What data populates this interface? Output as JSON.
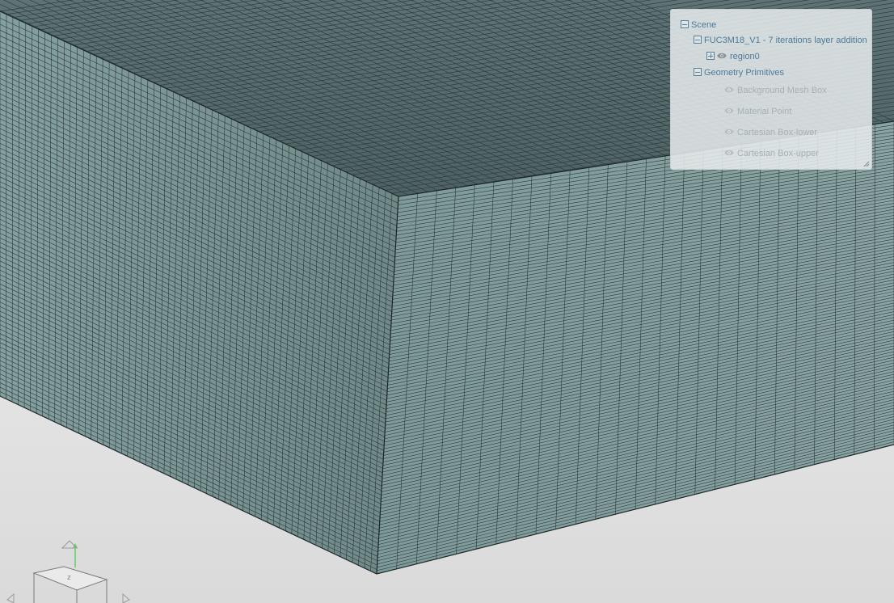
{
  "scene_tree": {
    "root_label": "Scene",
    "case_label": "FUC3M18_V1 - 7 iterations layer addition",
    "region_label": "region0",
    "primitives_label": "Geometry Primitives",
    "primitives": [
      {
        "label": "Background Mesh Box"
      },
      {
        "label": "Material Point"
      },
      {
        "label": "Cartesian Box-lower"
      },
      {
        "label": "Cartesian Box-upper"
      }
    ]
  },
  "view_cube": {
    "axis": "z",
    "axis_color": "#66cc66"
  },
  "colors": {
    "mesh_top": "#556a6c",
    "mesh_left": "#77908f",
    "mesh_right": "#7f9898",
    "mesh_line": "#2a3a3d",
    "link": "#4d7a9a"
  }
}
